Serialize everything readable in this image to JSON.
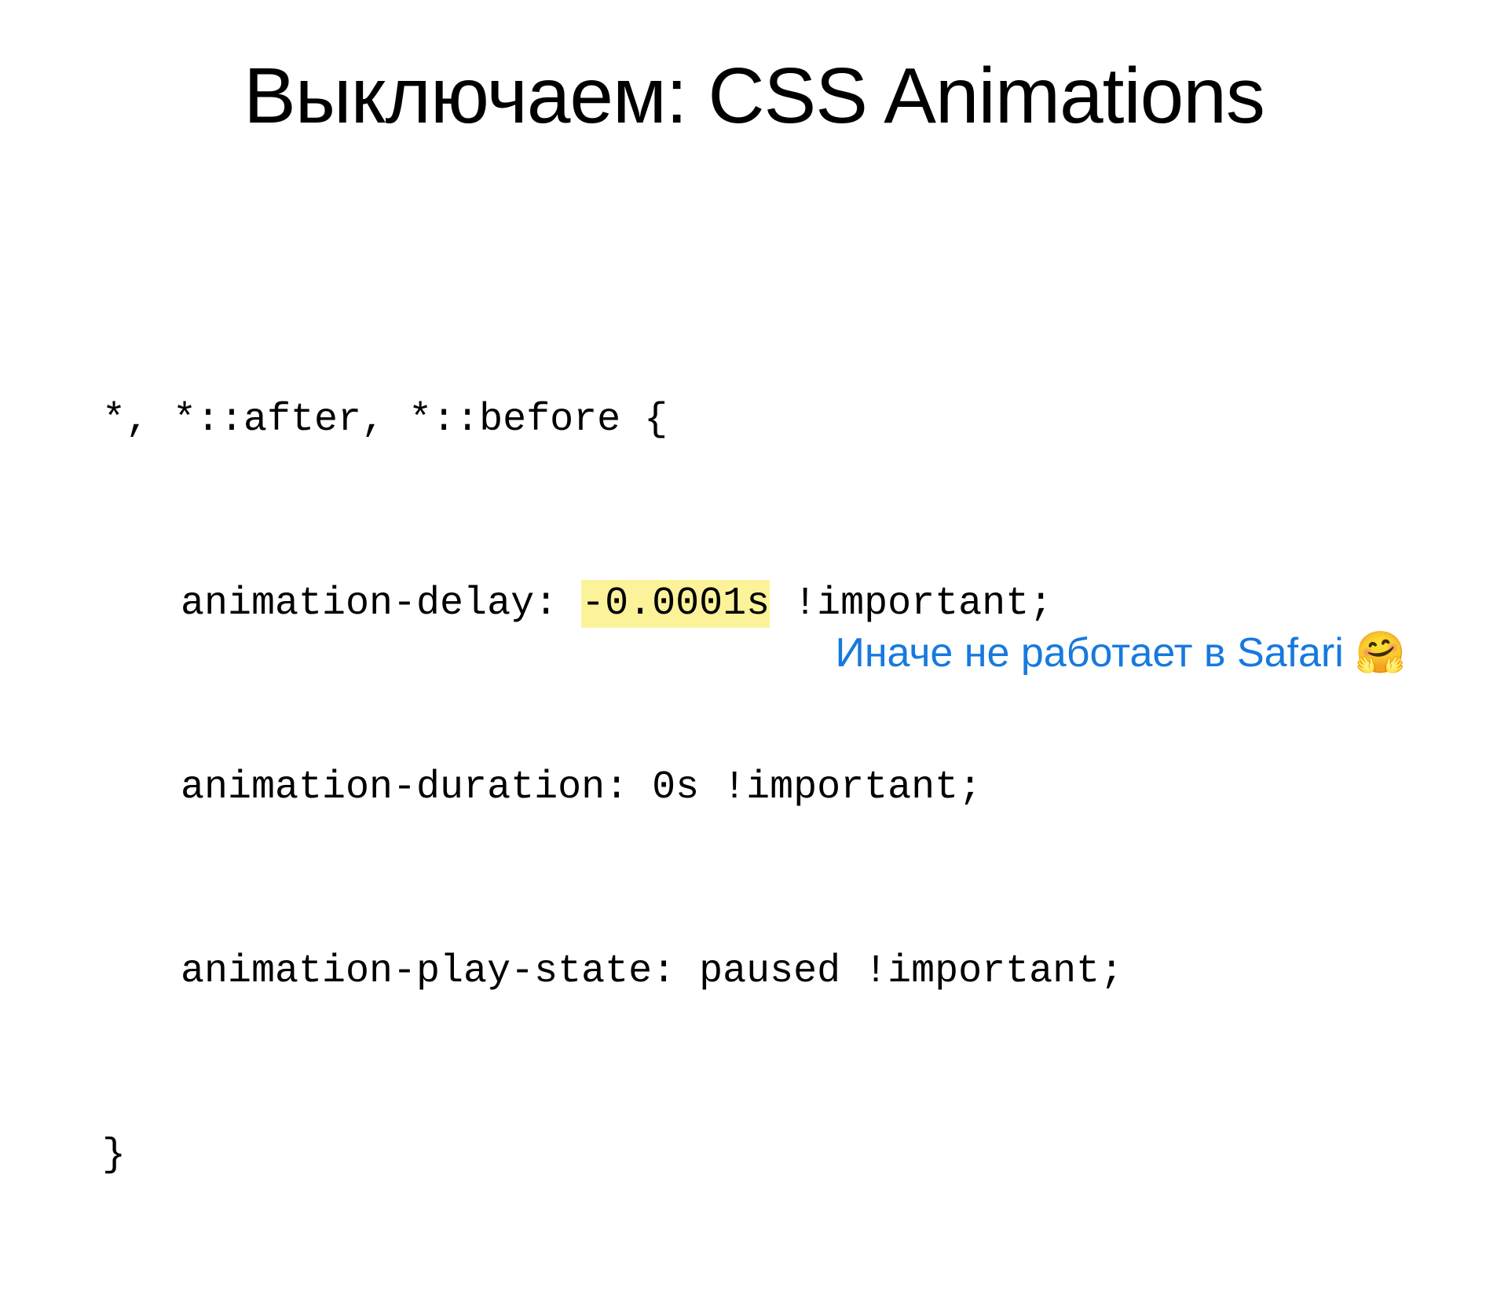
{
  "title": "Выключаем: CSS Animations",
  "code": {
    "line1": "*, *::after, *::before {",
    "line2_prop": "animation-delay: ",
    "line2_val_highlight": "-0.0001s",
    "line2_suffix": " !important;",
    "line3": "animation-duration: 0s !important;",
    "line4": "animation-play-state: paused !important;",
    "line5": "}"
  },
  "caption_text": "Иначе не работает в Safari ",
  "caption_emoji": "🤗"
}
